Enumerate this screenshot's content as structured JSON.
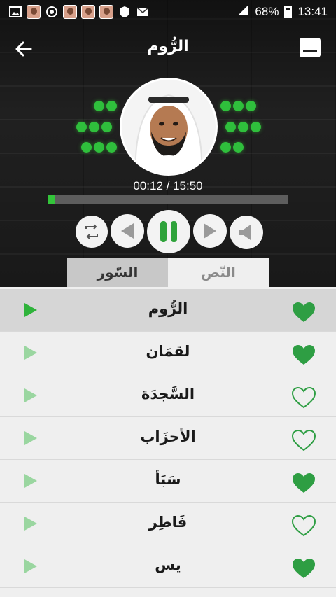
{
  "status_bar": {
    "battery": "68%",
    "time": "13:41"
  },
  "header": {
    "title": "الرُّوم"
  },
  "player": {
    "elapsed_total": "00:12 / 15:50",
    "progress_fraction": 0.027
  },
  "tabs": [
    {
      "label": "السّور",
      "selected": true
    },
    {
      "label": "النّص",
      "selected": false
    }
  ],
  "surahs": [
    {
      "name": "الرُّوم",
      "favorite": true,
      "active": true
    },
    {
      "name": "لقمَان",
      "favorite": true,
      "active": false
    },
    {
      "name": "السَّجدَة",
      "favorite": false,
      "active": false
    },
    {
      "name": "الأحزَاب",
      "favorite": false,
      "active": false
    },
    {
      "name": "سَبَأ",
      "favorite": true,
      "active": false
    },
    {
      "name": "فَاطِر",
      "favorite": false,
      "active": false
    },
    {
      "name": "يس",
      "favorite": true,
      "active": false
    }
  ],
  "colors": {
    "accent": "#2fbf3c",
    "heart": "#2e9e43"
  }
}
